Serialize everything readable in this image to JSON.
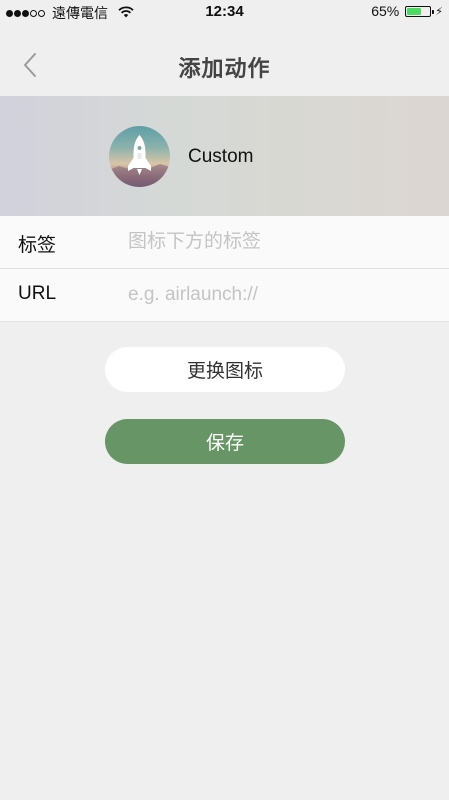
{
  "status_bar": {
    "carrier": "遠傳電信",
    "time": "12:34",
    "battery_percent_text": "65%",
    "battery_level": 0.65,
    "signal_bars_filled": 3,
    "signal_bars_total": 5
  },
  "nav": {
    "title": "添加动作",
    "back_icon": "chevron-left-icon"
  },
  "action": {
    "name": "Custom",
    "icon": "rocket-icon"
  },
  "form": {
    "label_field": {
      "label": "标签",
      "placeholder": "图标下方的标签",
      "value": ""
    },
    "url_field": {
      "label": "URL",
      "placeholder": "e.g. airlaunch://",
      "value": ""
    }
  },
  "buttons": {
    "change_icon": "更换图标",
    "save": "保存"
  },
  "colors": {
    "background": "#efefef",
    "save_button": "#679566",
    "battery": "#4cd964",
    "placeholder": "#c4c4c4"
  }
}
